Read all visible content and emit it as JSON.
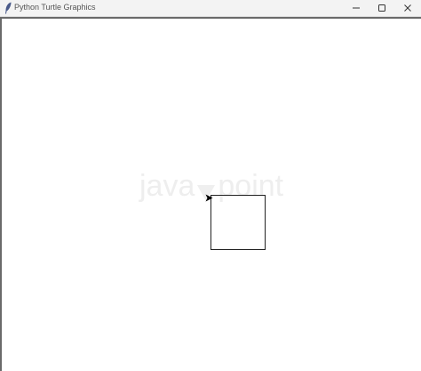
{
  "window": {
    "title": "Python Turtle Graphics",
    "controls": {
      "minimize": "minimize",
      "maximize": "maximize",
      "close": "close"
    }
  },
  "canvas": {
    "background": "#ffffff",
    "pen_color": "#000000"
  },
  "watermark": {
    "left": "java",
    "right": "point"
  },
  "icons": {
    "app": "feather-icon",
    "turtle": "arrow-cursor-icon"
  }
}
